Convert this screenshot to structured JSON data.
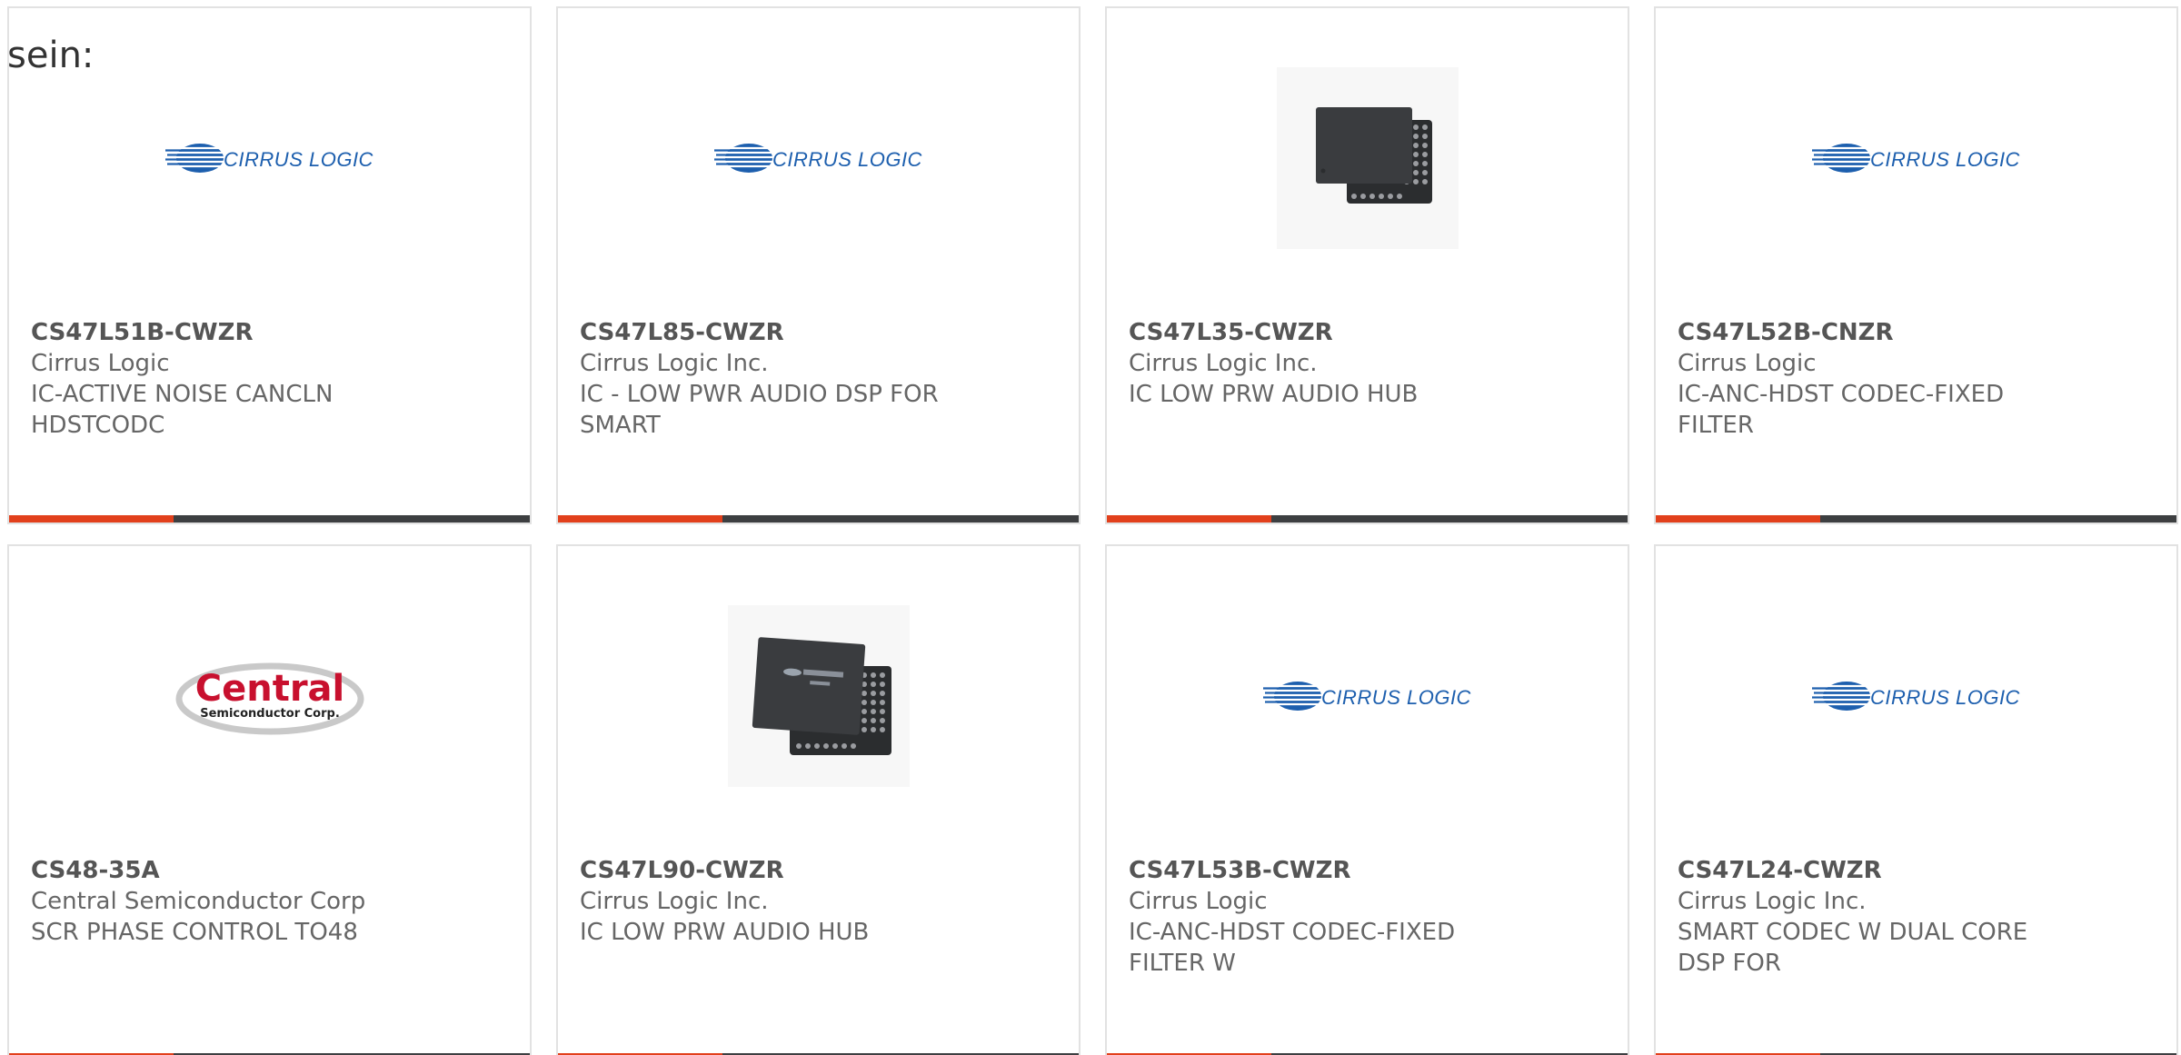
{
  "intro_text": "sein:",
  "colors": {
    "accent": "#e2401c",
    "bar": "#3d3f41",
    "border": "#e2e2e2",
    "cirrus_blue": "#1d5fae",
    "central_red": "#c8102e"
  },
  "products": [
    {
      "part": "CS47L51B-CWZR",
      "manufacturer": "Cirrus Logic",
      "description": "IC-ACTIVE NOISE CANCLN HDSTCODC",
      "image": "cirrus-logic-logo",
      "logo_text": "CIRRUS LOGIC"
    },
    {
      "part": "CS47L85-CWZR",
      "manufacturer": "Cirrus Logic Inc.",
      "description": "IC - LOW PWR AUDIO DSP FOR SMART",
      "image": "cirrus-logic-logo",
      "logo_text": "CIRRUS LOGIC"
    },
    {
      "part": "CS47L35-CWZR",
      "manufacturer": "Cirrus Logic Inc.",
      "description": "IC LOW PRW AUDIO HUB",
      "image": "bga-chip-photo"
    },
    {
      "part": "CS47L52B-CNZR",
      "manufacturer": "Cirrus Logic",
      "description": "IC-ANC-HDST CODEC-FIXED FILTER",
      "image": "cirrus-logic-logo",
      "logo_text": "CIRRUS LOGIC"
    },
    {
      "part": "CS48-35A",
      "manufacturer": "Central Semiconductor Corp",
      "description": "SCR PHASE CONTROL TO48",
      "image": "central-semiconductor-logo",
      "logo_text": "Central",
      "logo_subtext": "Semiconductor Corp."
    },
    {
      "part": "CS47L90-CWZR",
      "manufacturer": "Cirrus Logic Inc.",
      "description": "IC LOW PRW AUDIO HUB",
      "image": "bga-chip-photo-labeled"
    },
    {
      "part": "CS47L53B-CWZR",
      "manufacturer": "Cirrus Logic",
      "description": "IC-ANC-HDST CODEC-FIXED FILTER W",
      "image": "cirrus-logic-logo",
      "logo_text": "CIRRUS LOGIC"
    },
    {
      "part": "CS47L24-CWZR",
      "manufacturer": "Cirrus Logic Inc.",
      "description": "SMART CODEC W DUAL CORE DSP FOR",
      "image": "cirrus-logic-logo",
      "logo_text": "CIRRUS LOGIC"
    }
  ]
}
